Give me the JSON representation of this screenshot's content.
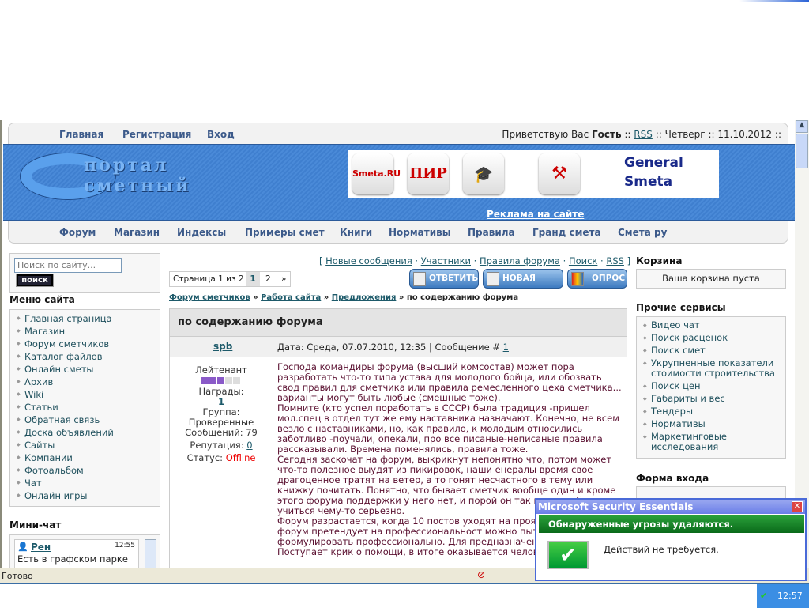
{
  "top_nav": {
    "links": [
      "Главная",
      "Регистрация",
      "Вход"
    ],
    "greeting_prefix": "Приветствую Вас",
    "user": "Гость",
    "sep": "::",
    "rss": "RSS",
    "day": "Четверг",
    "date": "11.10.2012"
  },
  "banner": {
    "logo_line1": "портал",
    "logo_line2": "сметный",
    "ads": [
      "Smeta.RU",
      "ПИР",
      "General Smeta"
    ],
    "ad_link": "Реклама на сайте"
  },
  "main_menu": [
    "Форум",
    "Магазин",
    "Индексы",
    "Примеры смет",
    "Книги",
    "Нормативы",
    "Правила",
    "Гранд смета",
    "Смета ру"
  ],
  "left": {
    "search_placeholder": "Поиск по сайту...",
    "search_button": "поиск",
    "menu_title": "Меню сайта",
    "menu": [
      "Главная страница",
      "Магазин",
      "Форум сметчиков",
      "Каталог файлов",
      "Онлайн сметы",
      "Архив",
      "Wiki",
      "Статьи",
      "Обратная связь",
      "Доска объявлений",
      "Сайты",
      "Компании",
      "Фотоальбом",
      "Чат",
      "Онлайн игры"
    ],
    "minichat_title": "Мини-чат",
    "chat": {
      "user": "Рен",
      "time": "12:55",
      "text": "Есть в графском парке"
    }
  },
  "forum": {
    "top_links": [
      "Новые сообщения",
      "Участники",
      "Правила форума",
      "Поиск",
      "RSS"
    ],
    "pager": {
      "label": "Страница 1 из 2",
      "pages": [
        "1",
        "2",
        "»"
      ]
    },
    "buttons": [
      "ОТВЕТИТЬ",
      "НОВАЯ ТЕМА",
      "ОПРОС"
    ],
    "breadcrumb": [
      "Форум сметчиков",
      "Работа сайта",
      "Предложения"
    ],
    "breadcrumb_current": "по содержанию форума",
    "sep": "»",
    "topic_title": "по содержанию форума",
    "post": {
      "author": "spb",
      "date": "Дата: Среда, 07.07.2010, 12:35 | Сообщение #",
      "number": "1",
      "rank": "Лейтенант",
      "rank_level": 3,
      "rank_max": 5,
      "awards_label": "Награды:",
      "awards": "1",
      "group_label": "Группа:",
      "group": "Проверенные",
      "messages": "Сообщений: 79",
      "rep_label": "Репутация:",
      "rep": "0",
      "status_label": "Статус:",
      "status": "Offline",
      "lines": [
        "Господа командиры форума (высший комсостав) может пора разработать что-то типа устава для молодого бойца, или обозвать свод правил для сметчика или правила ремесленного цеха сметчика... варианты могут быть любые (смешные тоже).",
        "Помните (кто успел поработать в СССР) была традиция -пришел мол.спец в отдел тут же ему наставника назначают. Конечно, не всем везло с наставниками, но, как правило, к молодым относились заботливо -поучали, опекали, про все писаные-неписаные правила рассказывали. Времена поменялись, правила тоже.",
        "Сегодня заскочат на форум, выкрикнут непонятно что, потом может что-то полезное выудят из пикировок, наши енералы время свое драгоценное тратят на ветер, а то гонят несчастного в тему или книжку почитать. Понятно, что бывает сметчик вообще один и кроме этого форума поддержки у него нет, и порой он так и не узн бы учиться чему-то серьезно.",
        "Форум разрастается, когда 10 постов уходят на проясн вопрос. Если форум претендует на профессиональност можно пытаться формулировать профессионально. Для предназначен чат (да?).",
        "Поступает крик о помощи, в итоге оказывается челове"
      ]
    }
  },
  "right": {
    "cart_title": "Корзина",
    "cart_text": "Ваша корзина пуста",
    "services_title": "Прочие сервисы",
    "services": [
      "Видео чат",
      "Поиск расценок",
      "Поиск смет",
      "Укрупненные показатели стоимости строительства",
      "Поиск цен",
      "Габариты и вес",
      "Тендеры",
      "Нормативы",
      "Маркетинговые исследования"
    ],
    "login_title": "Форма входа"
  },
  "status_bar": {
    "text": "Готово"
  },
  "mse": {
    "title": "Microsoft Security Essentials",
    "headline": "Обнаруженные угрозы удаляются.",
    "message": "Действий не требуется."
  },
  "taskbar": {
    "clock": "12:57"
  }
}
